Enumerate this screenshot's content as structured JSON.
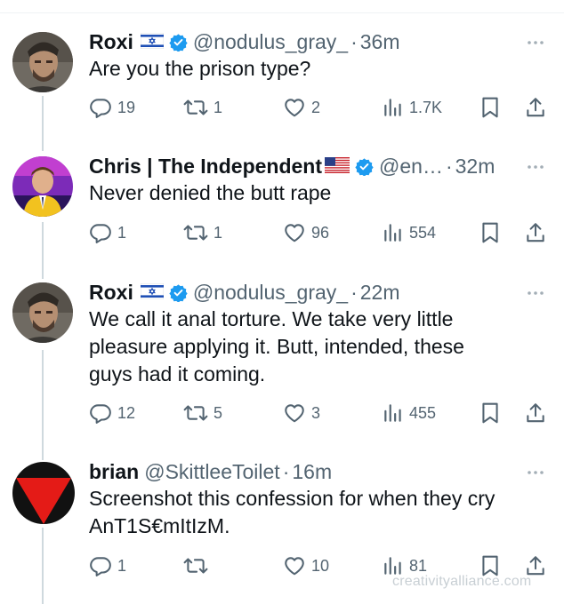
{
  "tweets": [
    {
      "name": "Roxi",
      "flag": "israel",
      "verified": true,
      "handle": "@nodulus_gray_",
      "time": "36m",
      "text": "Are you the prison type?",
      "replies": "19",
      "retweets": "1",
      "likes": "2",
      "views": "1.7K"
    },
    {
      "name": "Chris | The Independent",
      "flag": "usa",
      "verified": true,
      "handle": "@en…",
      "time": "32m",
      "text": "Never denied the butt rape",
      "replies": "1",
      "retweets": "1",
      "likes": "96",
      "views": "554"
    },
    {
      "name": "Roxi",
      "flag": "israel",
      "verified": true,
      "handle": "@nodulus_gray_",
      "time": "22m",
      "text": "We call it anal torture. We take very little\npleasure applying it. Butt, intended, these\nguys had it coming.",
      "replies": "12",
      "retweets": "5",
      "likes": "3",
      "views": "455"
    },
    {
      "name": "brian",
      "flag": "",
      "verified": false,
      "handle": "@SkittleeToilet",
      "time": "16m",
      "text": "Screenshot this confession for when they cry\nAnT1S€mItIzM.",
      "replies": "1",
      "retweets": "",
      "likes": "10",
      "views": "81"
    }
  ],
  "separator": "·",
  "watermark": "creativityalliance.com",
  "colors": {
    "text": "#0f1419",
    "muted": "#536471",
    "verified": "#1d9bf0",
    "thread": "#cfd9de"
  }
}
